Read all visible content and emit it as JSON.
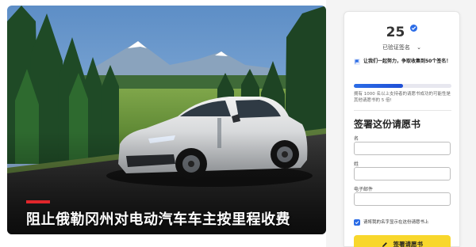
{
  "hero": {
    "title": "阻止俄勒冈州对电动汽车车主按里程收费"
  },
  "petition": {
    "signature_count": "25",
    "verified_label": "已验证签名",
    "goal_message": "让我们一起努力，争取收集到50个签名！",
    "progress_fraction": 0.5,
    "progress_note": "拥有 1000 名以上支持者的请愿书成功的可能性是其他请愿书的 5 倍!"
  },
  "form": {
    "title": "签署这份请愿书",
    "first_name_label": "名",
    "last_name_label": "姓",
    "email_label": "电子邮件",
    "first_name_value": "",
    "last_name_value": "",
    "email_value": "",
    "consent_text": "请将我的名字显示在这份请愿书上",
    "consent_checked": true,
    "submit_label": "签署请愿书"
  },
  "colors": {
    "accent_blue": "#2b6ce6",
    "button_yellow": "#f8d72c",
    "title_bar_red": "#e0262b"
  }
}
